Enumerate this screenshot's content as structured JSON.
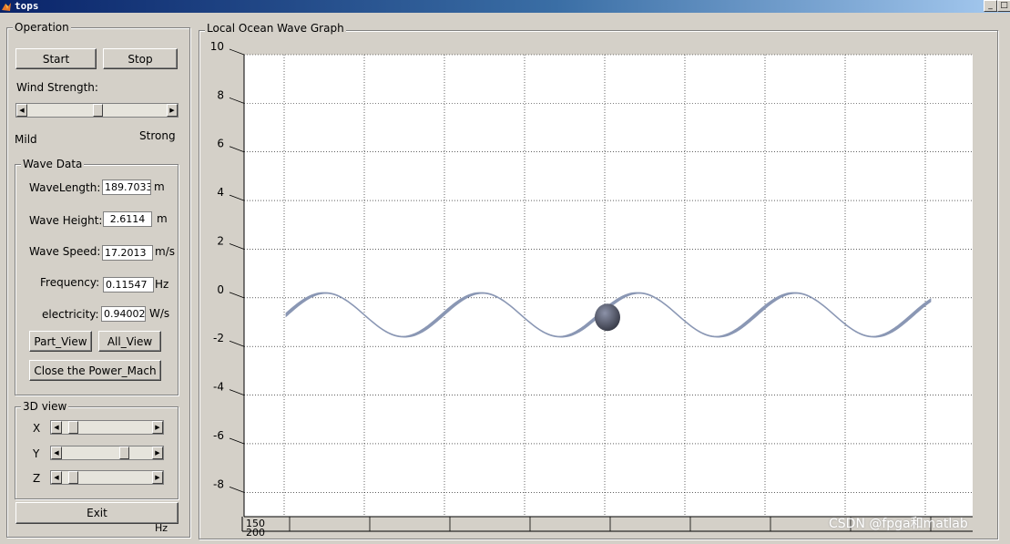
{
  "window": {
    "title": "tops"
  },
  "operation": {
    "title": "Operation",
    "start_label": "Start",
    "stop_label": "Stop",
    "wind_label": "Wind Strength:",
    "wind_min_label": "Mild",
    "wind_max_label": "Strong",
    "wind_level": 0.5
  },
  "wave_data": {
    "title": "Wave Data",
    "wavelength_label": "WaveLength:",
    "wavelength_value": "189.7033",
    "wavelength_unit": "m",
    "height_label": "Wave Height:",
    "height_value": "2.6114",
    "height_unit": "m",
    "speed_label": "Wave Speed:",
    "speed_value": "17.2013",
    "speed_unit": "m/s",
    "frequency_label": "Frequency:",
    "frequency_value": "0.11547",
    "frequency_unit": "Hz",
    "electricity_label": "electricity:",
    "electricity_value": "0.94002",
    "electricity_unit": "W/s",
    "part_view_label": "Part_View",
    "all_view_label": "All_View",
    "close_label": "Close the Power_Mach"
  },
  "view3d": {
    "title": "3D view",
    "x_label": "X",
    "x_level": 0.08,
    "y_label": "Y",
    "y_level": 0.7,
    "z_label": "Z",
    "z_level": 0.08
  },
  "exit_label": "Exit",
  "stray_unit": "Hz",
  "graph": {
    "title": "Local Ocean Wave Graph"
  },
  "chart_data": {
    "type": "line",
    "title": "",
    "ylim": [
      -9,
      10
    ],
    "yticks": [
      "10",
      "8",
      "6",
      "4",
      "2",
      "0",
      "-2",
      "-4",
      "-6",
      "-8"
    ],
    "xtick_labels": [
      "150",
      "200"
    ],
    "grid": true,
    "wave_color": "#8a97b4",
    "buoy_color": "#3a3d4a"
  },
  "watermark": "CSDN @fpga和matlab"
}
